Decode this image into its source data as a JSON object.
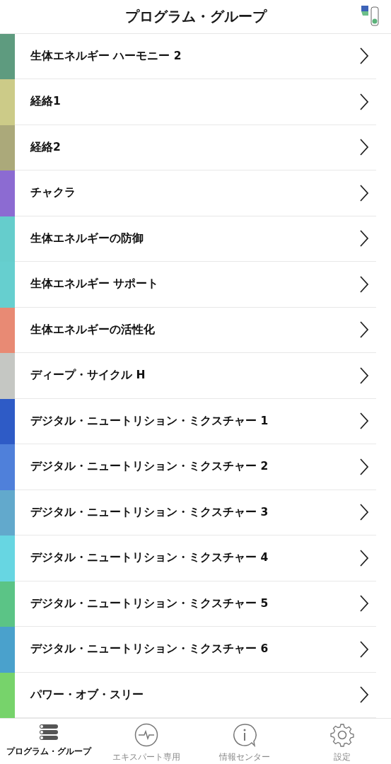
{
  "header": {
    "title": "プログラム・グループ"
  },
  "groups": [
    {
      "label": "生体エネルギー ハーモニー 2",
      "color": "#5e9b7f"
    },
    {
      "label": "経絡1",
      "color": "#cccb88"
    },
    {
      "label": "経絡2",
      "color": "#aba97a"
    },
    {
      "label": "チャクラ",
      "color": "#8c6bd2"
    },
    {
      "label": "生体エネルギーの防御",
      "color": "#65cdcc"
    },
    {
      "label": "生体エネルギー サポート",
      "color": "#66cfcf"
    },
    {
      "label": "生体エネルギーの活性化",
      "color": "#e88a74"
    },
    {
      "label": "ディープ・サイクル H",
      "color": "#c5c7c3"
    },
    {
      "label": "デジタル・ニュートリション・ミクスチャー 1",
      "color": "#2e5bc6"
    },
    {
      "label": "デジタル・ニュートリション・ミクスチャー 2",
      "color": "#4f80da"
    },
    {
      "label": "デジタル・ニュートリション・ミクスチャー 3",
      "color": "#62a9cc"
    },
    {
      "label": "デジタル・ニュートリション・ミクスチャー 4",
      "color": "#67d6e2"
    },
    {
      "label": "デジタル・ニュートリション・ミクスチャー 5",
      "color": "#5bc486"
    },
    {
      "label": "デジタル・ニュートリション・ミクスチャー 6",
      "color": "#4aa1cc"
    },
    {
      "label": "パワー・オブ・スリー",
      "color": "#77d36b"
    }
  ],
  "tabs": [
    {
      "label": "プログラム・グループ",
      "kind": "list",
      "selected": true
    },
    {
      "label": "エキスパート専用",
      "kind": "pulse",
      "selected": false
    },
    {
      "label": "情報センター",
      "kind": "info",
      "selected": false
    },
    {
      "label": "設定",
      "kind": "gear",
      "selected": false
    }
  ]
}
